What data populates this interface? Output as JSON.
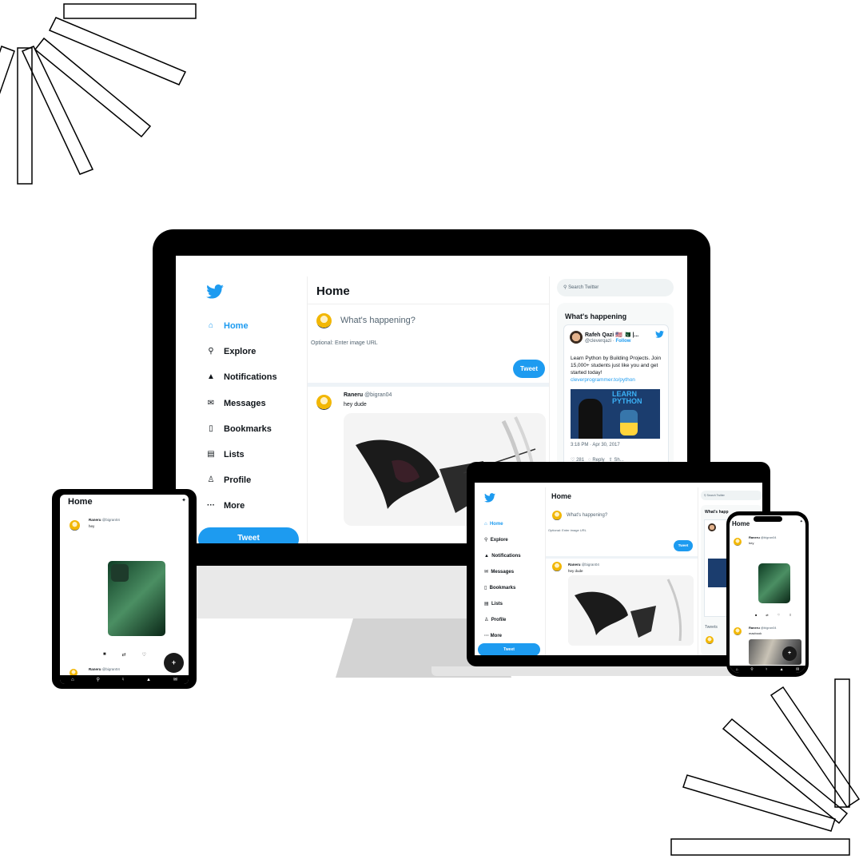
{
  "desktop": {
    "nav": [
      {
        "label": "Home",
        "icon": "home-icon",
        "active": true
      },
      {
        "label": "Explore",
        "icon": "search-icon"
      },
      {
        "label": "Notifications",
        "icon": "bell-icon"
      },
      {
        "label": "Messages",
        "icon": "mail-icon"
      },
      {
        "label": "Bookmarks",
        "icon": "bookmark-icon"
      },
      {
        "label": "Lists",
        "icon": "list-icon"
      },
      {
        "label": "Profile",
        "icon": "profile-icon"
      },
      {
        "label": "More",
        "icon": "more-icon"
      }
    ],
    "tweet_button": "Tweet",
    "feed": {
      "title": "Home",
      "compose_placeholder": "What's happening?",
      "image_url_placeholder": "Optional: Enter image URL",
      "compose_button": "Tweet",
      "post": {
        "name": "Raneru",
        "handle": "@bigran04",
        "text": "hey dude"
      }
    },
    "search_placeholder": "Search Twitter",
    "whats_happening": {
      "title": "What's happening",
      "card": {
        "name": "Rafeh Qazi 🇺🇸 🇵🇰 |...",
        "handle": "@cleverqazi",
        "follow": "Follow",
        "text": "Learn Python by Building Projects. Join 15,000+ students just like you and get started today!",
        "link": "cleverprogrammer.to/python",
        "image_text_1": "LEARN",
        "image_text_2": "PYTHON",
        "time": "3:18 PM · Apr 30, 2017",
        "likes": "281",
        "reply": "Reply",
        "share": "Sh..."
      }
    }
  },
  "laptop": {
    "nav": [
      "Home",
      "Explore",
      "Notifications",
      "Messages",
      "Bookmarks",
      "Lists",
      "Profile",
      "More"
    ],
    "title": "Home",
    "compose_placeholder": "What's happening?",
    "image_url_placeholder": "Optional: Enter image URL",
    "compose_button": "Tweet",
    "post": {
      "name": "Raneru",
      "handle": "@bigran04",
      "text": "hey dude"
    },
    "search_placeholder": "Search Twitter",
    "trend_title": "What's happ",
    "tweets_label": "Tweets",
    "tweet_button": "Tweet"
  },
  "tablet": {
    "title": "Home",
    "post": {
      "name": "Raneru",
      "handle": "@bigran04",
      "text": "hey"
    },
    "post2": {
      "name": "Raneru",
      "handle": "@bigran04"
    },
    "fab": "+"
  },
  "phone": {
    "title": "Home",
    "post": {
      "name": "Raneru",
      "handle": "@bigran04",
      "text": "hey"
    },
    "post2": {
      "name": "Raneru",
      "handle": "@bigran04",
      "text": "macbook"
    },
    "fab": "+"
  },
  "colors": {
    "accent": "#1d9bf0",
    "device_frame": "#000000",
    "stand": "#d3d3d3"
  }
}
